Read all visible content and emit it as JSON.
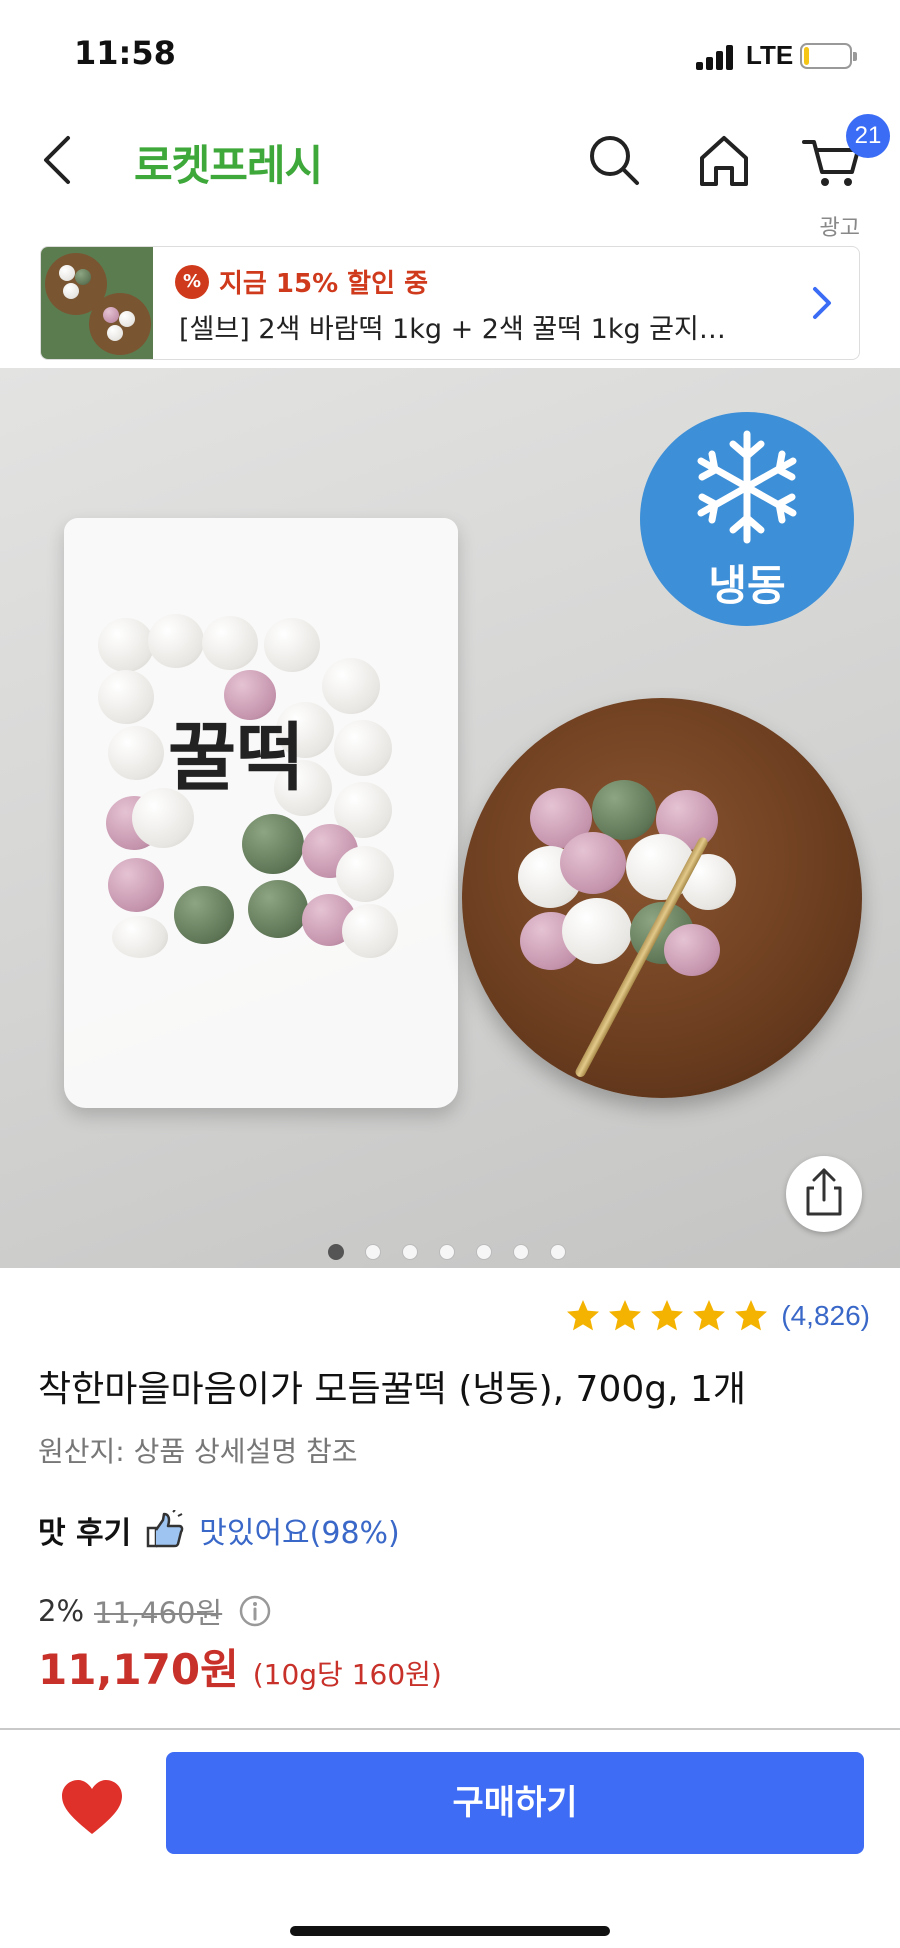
{
  "status_bar": {
    "time": "11:58",
    "network": "LTE",
    "battery_level": 0.12
  },
  "header": {
    "title": "로켓프레시",
    "back_icon": "chevron-left-icon",
    "search_icon": "search-icon",
    "home_icon": "home-icon",
    "cart_icon": "cart-icon",
    "cart_count": "21",
    "brand_color": "#3ea83a"
  },
  "ad": {
    "label": "광고",
    "discount_text": "지금 15% 할인 중",
    "title": "[셀브] 2색 바람떡 1kg + 2색 꿀떡 1kg 굳지…"
  },
  "product_image": {
    "badge_text": "냉동",
    "bag_label": "꿀떡",
    "total_slides": 7,
    "active_slide": 1
  },
  "product": {
    "rating_stars": 5,
    "review_count": "(4,826)",
    "title": "착한마을마음이가 모듬꿀떡 (냉동), 700g, 1개",
    "origin": "원산지: 상품 상세설명 참조",
    "taste_label": "맛 후기",
    "taste_value": "맛있어요(98%)",
    "discount_rate": "2%",
    "original_price": "11,460원",
    "sale_price": "11,170원",
    "unit_price": "(10g당 160원)"
  },
  "bottom_bar": {
    "buy_label": "구매하기",
    "buy_color": "#3e6cf4",
    "heart_color": "#e0302a"
  }
}
